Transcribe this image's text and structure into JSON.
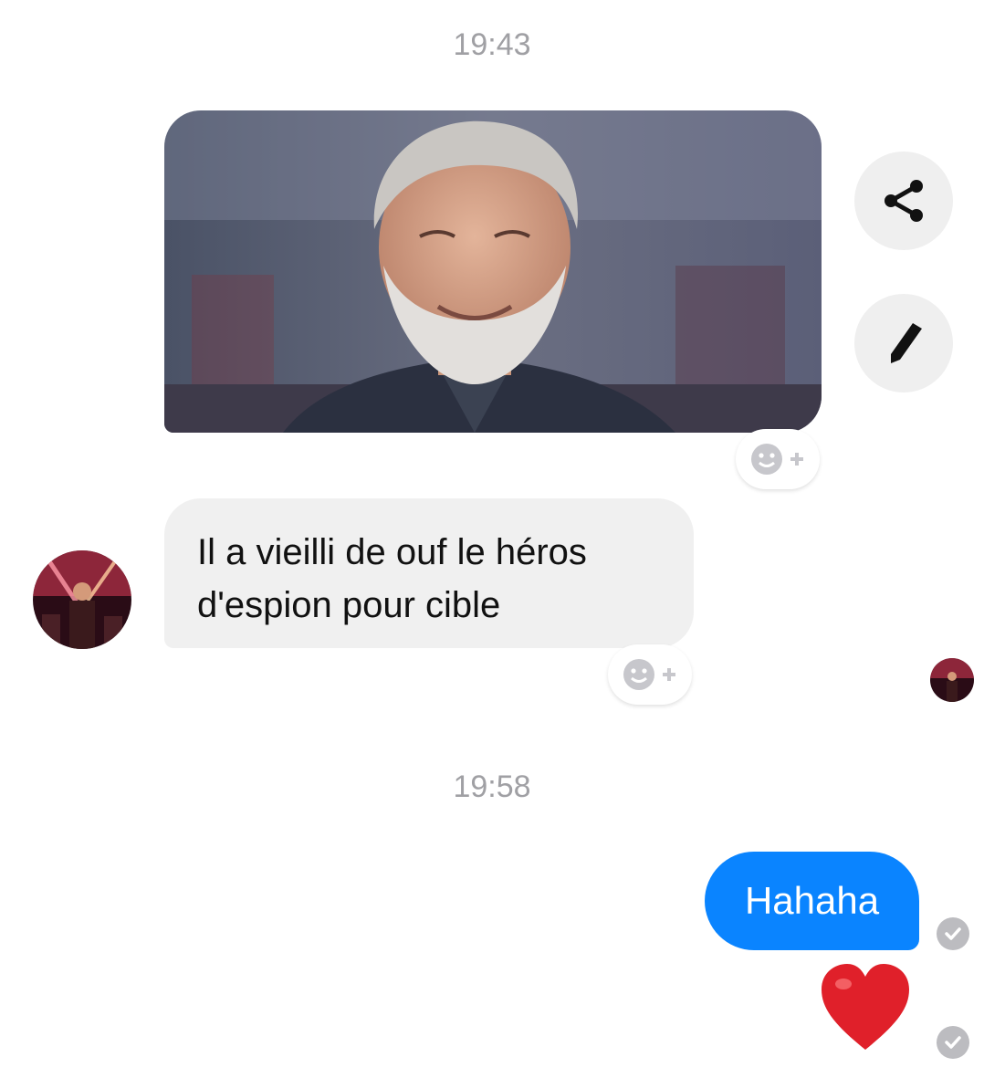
{
  "thread": {
    "timestamps": [
      "19:43",
      "19:58"
    ],
    "incoming_text": "Il a vieilli de ouf le héros d'espion pour cible",
    "outgoing_text": "Hahaha",
    "outgoing_emoji": "❤️"
  },
  "icons": {
    "share": "share-icon",
    "edit": "pencil-icon",
    "react": "add-reaction-icon",
    "seen": "check-icon"
  },
  "colors": {
    "outgoing_bubble": "#0a84ff",
    "incoming_bubble": "#f0f0f0",
    "timestamp": "#a0a0a4",
    "heart": "#e0202a"
  }
}
